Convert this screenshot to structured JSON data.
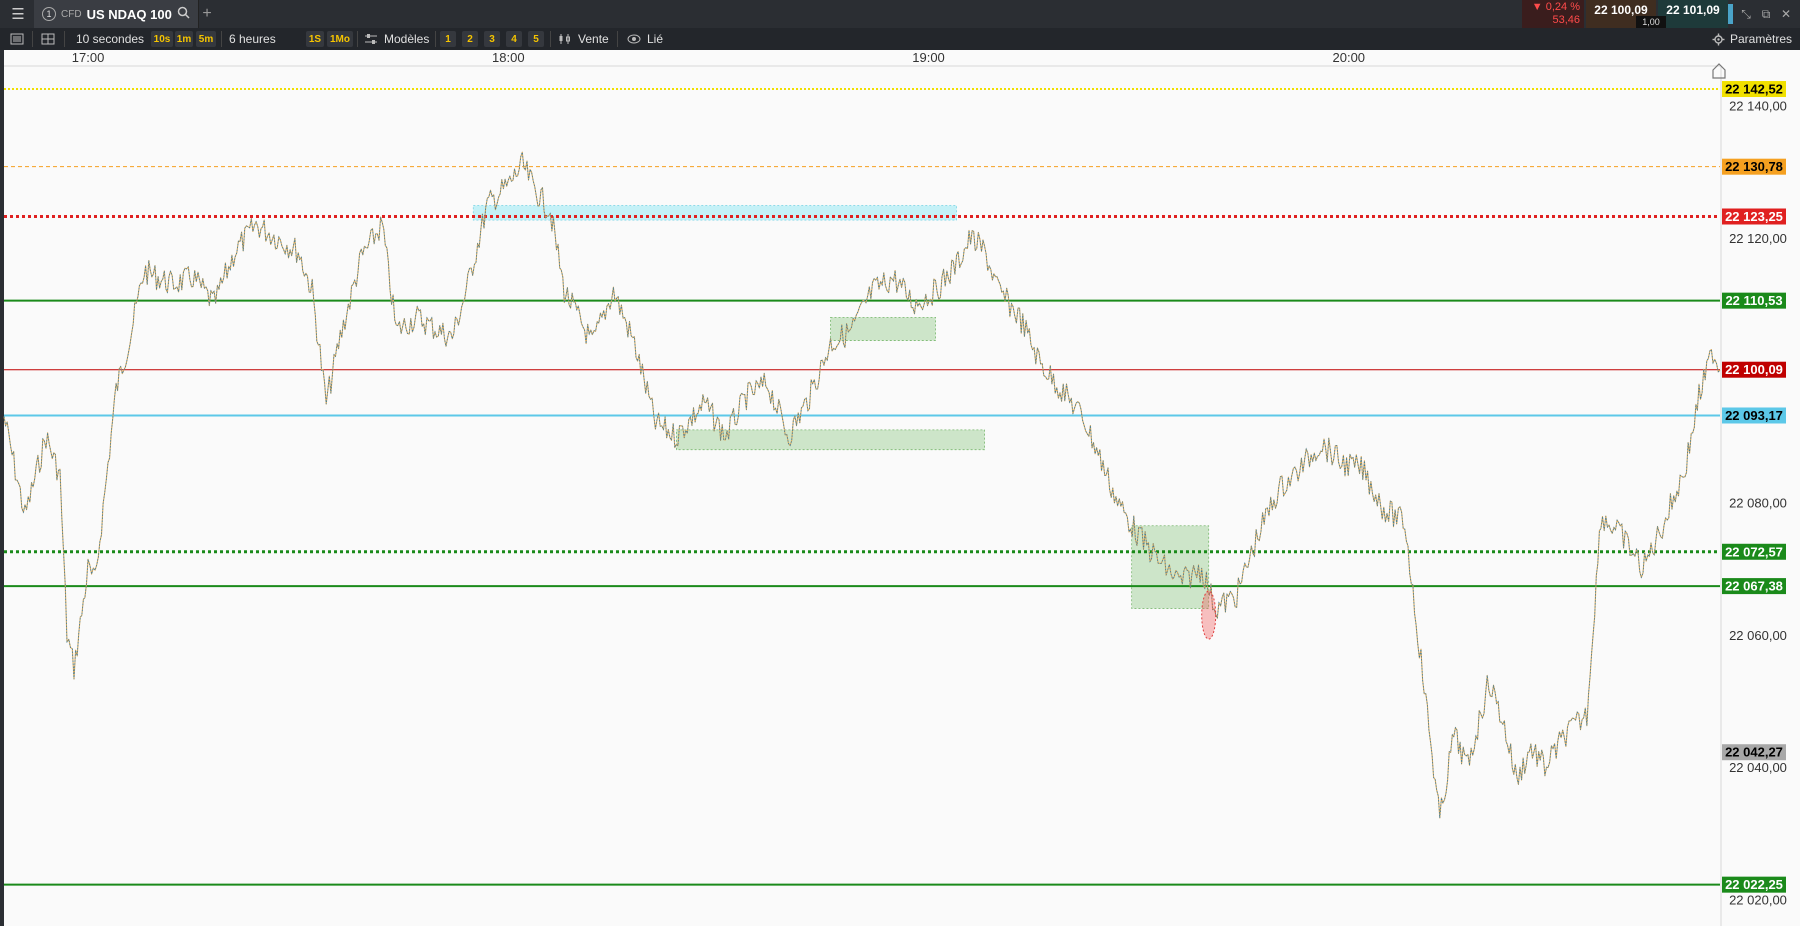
{
  "topbar": {
    "menu_icon": "hamburger-icon",
    "tab_number": "1",
    "cfd": "CFD",
    "instrument": "US NDAQ 100",
    "search_icon": "search-icon",
    "plus": "+",
    "change_pct": "▼ 0,24 %",
    "change_abs": "53,46",
    "bid": "22 100,09",
    "ask": "22 101,09",
    "spread": "1,00",
    "window_controls": [
      "⤡",
      "⧉",
      "✕"
    ]
  },
  "toolbar": {
    "interval": "10 secondes",
    "quick_intervals": [
      "10s",
      "1m",
      "5m"
    ],
    "range": "6 heures",
    "quick_ranges": [
      "1S",
      "1Mo"
    ],
    "templates": "Modèles",
    "layouts": [
      "1",
      "2",
      "3",
      "4",
      "5"
    ],
    "order_side": "Vente",
    "linked": "Lié",
    "settings": "Paramètres"
  },
  "chart_data": {
    "type": "candlestick",
    "x_ticks": [
      "17:00",
      "18:00",
      "19:00",
      "20:00"
    ],
    "y_ticks": [
      "22 140,00",
      "22 120,00",
      "22 080,00",
      "22 060,00",
      "22 040,00",
      "22 020,00"
    ],
    "y_tick_values": [
      22140,
      22120,
      22080,
      22060,
      22040,
      22020
    ],
    "ylim": [
      22016,
      22146
    ],
    "xlim": [
      "16:48",
      "20:53"
    ],
    "price_levels": [
      {
        "label": "22 142,52",
        "value": 22142.52,
        "color": "#f0e000",
        "text_color": "#000000",
        "style": "dotted"
      },
      {
        "label": "22 130,78",
        "value": 22130.78,
        "color": "#f5a020",
        "text_color": "#000000",
        "style": "dashed"
      },
      {
        "label": "22 123,25",
        "value": 22123.25,
        "color": "#e02020",
        "text_color": "#ffffff",
        "style": "dotted-thick"
      },
      {
        "label": "22 110,53",
        "value": 22110.53,
        "color": "#1a8a1a",
        "text_color": "#ffffff",
        "style": "solid"
      },
      {
        "label": "22 100,09",
        "value": 22100.09,
        "color": "#c00000",
        "text_color": "#ffffff",
        "style": "thin"
      },
      {
        "label": "22 093,17",
        "value": 22093.17,
        "color": "#5cc8e8",
        "text_color": "#000000",
        "style": "solid"
      },
      {
        "label": "22 072,57",
        "value": 22072.57,
        "color": "#1a8a1a",
        "text_color": "#ffffff",
        "style": "dotted-thick"
      },
      {
        "label": "22 067,38",
        "value": 22067.38,
        "color": "#1a8a1a",
        "text_color": "#ffffff",
        "style": "solid"
      },
      {
        "label": "22 042,27",
        "value": 22042.27,
        "color": "#a8a8a8",
        "text_color": "#000000",
        "style": "none"
      },
      {
        "label": "22 022,25",
        "value": 22022.25,
        "color": "#1a8a1a",
        "text_color": "#ffffff",
        "style": "solid"
      }
    ],
    "zones": [
      {
        "color": "cyan",
        "x_from": "17:55",
        "x_to": "19:04",
        "y_from": 22122.7,
        "y_to": 22124.9
      },
      {
        "color": "green",
        "x_from": "18:46",
        "x_to": "19:01",
        "y_from": 22104.5,
        "y_to": 22108.0
      },
      {
        "color": "green",
        "x_from": "18:24",
        "x_to": "19:08",
        "y_from": 22088.0,
        "y_to": 22091.0
      },
      {
        "color": "green",
        "x_from": "19:29",
        "x_to": "19:40",
        "y_from": 22064.0,
        "y_to": 22076.5
      }
    ],
    "marker": {
      "color": "red",
      "x": "19:40",
      "y": 22063.0
    },
    "path": [
      [
        "16:48",
        22093
      ],
      [
        "16:51",
        22078
      ],
      [
        "16:54",
        22090
      ],
      [
        "16:56",
        22084
      ],
      [
        "16:57",
        22060
      ],
      [
        "16:58",
        22055
      ],
      [
        "17:00",
        22070
      ],
      [
        "17:01",
        22068
      ],
      [
        "17:04",
        22097
      ],
      [
        "17:06",
        22105
      ],
      [
        "17:08",
        22115
      ],
      [
        "17:12",
        22113
      ],
      [
        "17:15",
        22114
      ],
      [
        "17:18",
        22110
      ],
      [
        "17:21",
        22118
      ],
      [
        "17:24",
        22122
      ],
      [
        "17:27",
        22120
      ],
      [
        "17:30",
        22118
      ],
      [
        "17:32",
        22112
      ],
      [
        "17:34",
        22095
      ],
      [
        "17:36",
        22105
      ],
      [
        "17:39",
        22117
      ],
      [
        "17:42",
        22122
      ],
      [
        "17:44",
        22106
      ],
      [
        "17:47",
        22108
      ],
      [
        "17:50",
        22106
      ],
      [
        "17:52",
        22105
      ],
      [
        "17:54",
        22112
      ],
      [
        "17:57",
        22125
      ],
      [
        "18:00",
        22128
      ],
      [
        "18:02",
        22131
      ],
      [
        "18:04",
        22127
      ],
      [
        "18:06",
        22124
      ],
      [
        "18:08",
        22112
      ],
      [
        "18:12",
        22104
      ],
      [
        "18:15",
        22112
      ],
      [
        "18:18",
        22104
      ],
      [
        "18:21",
        22092
      ],
      [
        "18:24",
        22090
      ],
      [
        "18:28",
        22095
      ],
      [
        "18:31",
        22090
      ],
      [
        "18:34",
        22096
      ],
      [
        "18:37",
        22098
      ],
      [
        "18:40",
        22090
      ],
      [
        "18:43",
        22096
      ],
      [
        "18:46",
        22104
      ],
      [
        "18:49",
        22106
      ],
      [
        "18:52",
        22112
      ],
      [
        "18:55",
        22114
      ],
      [
        "18:58",
        22110
      ],
      [
        "19:01",
        22112
      ],
      [
        "19:04",
        22116
      ],
      [
        "19:06",
        22120
      ],
      [
        "19:08",
        22118
      ],
      [
        "19:10",
        22112
      ],
      [
        "19:13",
        22108
      ],
      [
        "19:16",
        22101
      ],
      [
        "19:19",
        22097
      ],
      [
        "19:22",
        22093
      ],
      [
        "19:24",
        22088
      ],
      [
        "19:27",
        22080
      ],
      [
        "19:30",
        22075
      ],
      [
        "19:33",
        22071
      ],
      [
        "19:36",
        22068
      ],
      [
        "19:39",
        22070
      ],
      [
        "19:41",
        22064
      ],
      [
        "19:44",
        22066
      ],
      [
        "19:47",
        22075
      ],
      [
        "19:50",
        22082
      ],
      [
        "19:53",
        22085
      ],
      [
        "19:56",
        22089
      ],
      [
        "19:59",
        22086
      ],
      [
        "20:02",
        22085
      ],
      [
        "20:05",
        22079
      ],
      [
        "20:08",
        22077
      ],
      [
        "20:11",
        22050
      ],
      [
        "20:13",
        22032
      ],
      [
        "20:15",
        22045
      ],
      [
        "20:17",
        22040
      ],
      [
        "20:20",
        22053
      ],
      [
        "20:22",
        22047
      ],
      [
        "20:24",
        22038
      ],
      [
        "20:26",
        22043
      ],
      [
        "20:28",
        22040
      ],
      [
        "20:31",
        22045
      ],
      [
        "20:34",
        22048
      ],
      [
        "20:36",
        22078
      ],
      [
        "20:39",
        22075
      ],
      [
        "20:42",
        22070
      ],
      [
        "20:45",
        22077
      ],
      [
        "20:48",
        22085
      ],
      [
        "20:50",
        22096
      ],
      [
        "20:52",
        22103
      ],
      [
        "20:53",
        22100
      ]
    ]
  }
}
